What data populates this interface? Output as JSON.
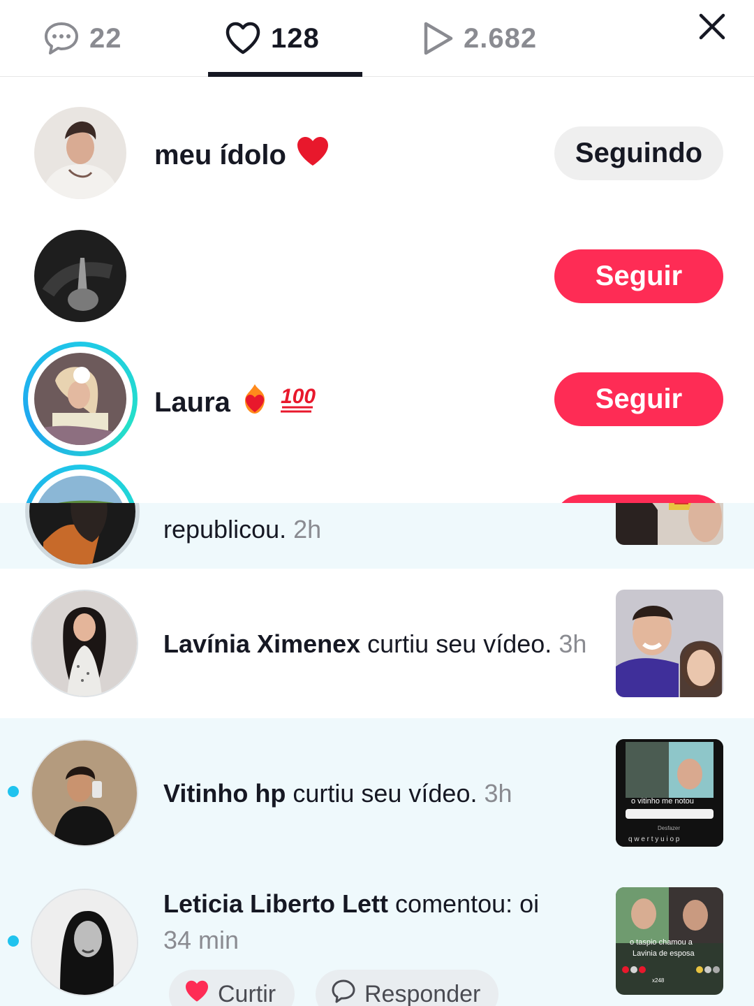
{
  "stats_bar": {
    "comments_count": "22",
    "likes_count": "128",
    "views_count": "2.682"
  },
  "likers": [
    {
      "name": "meu ídolo",
      "emoji": "❤️",
      "button": "Seguindo"
    },
    {
      "name": "",
      "emoji": "",
      "button": "Seguir"
    },
    {
      "name": "Laura",
      "emoji": "❤️‍🔥💯",
      "button": "Seguir"
    }
  ],
  "notifications": [
    {
      "actor": "",
      "action": "republicou.",
      "time": "2h"
    },
    {
      "actor": "Lavínia Ximenex",
      "action": "curtiu seu vídeo.",
      "time": "3h"
    },
    {
      "actor": "Vitinho hp",
      "action": "curtiu seu vídeo.",
      "time": "3h",
      "thumb_caption": "o vitinho me notou",
      "thumb_undo": "Desfazer",
      "thumb_keys": "q w e r t y u i o p"
    },
    {
      "actor": "Leticia Liberto Lett",
      "action": "comentou: oi",
      "time": "34 min",
      "thumb_caption_1": "o taspio chamou a",
      "thumb_caption_2": "Lavinia de esposa",
      "thumb_count": "x248"
    }
  ],
  "comment_actions": {
    "like": "Curtir",
    "reply": "Responder"
  },
  "colors": {
    "follow": "#fe2c55",
    "following": "#efefef",
    "unread_bg": "#eff9fc",
    "unread_dot": "#20c3ee",
    "story_ring": "#1fc8e8"
  }
}
